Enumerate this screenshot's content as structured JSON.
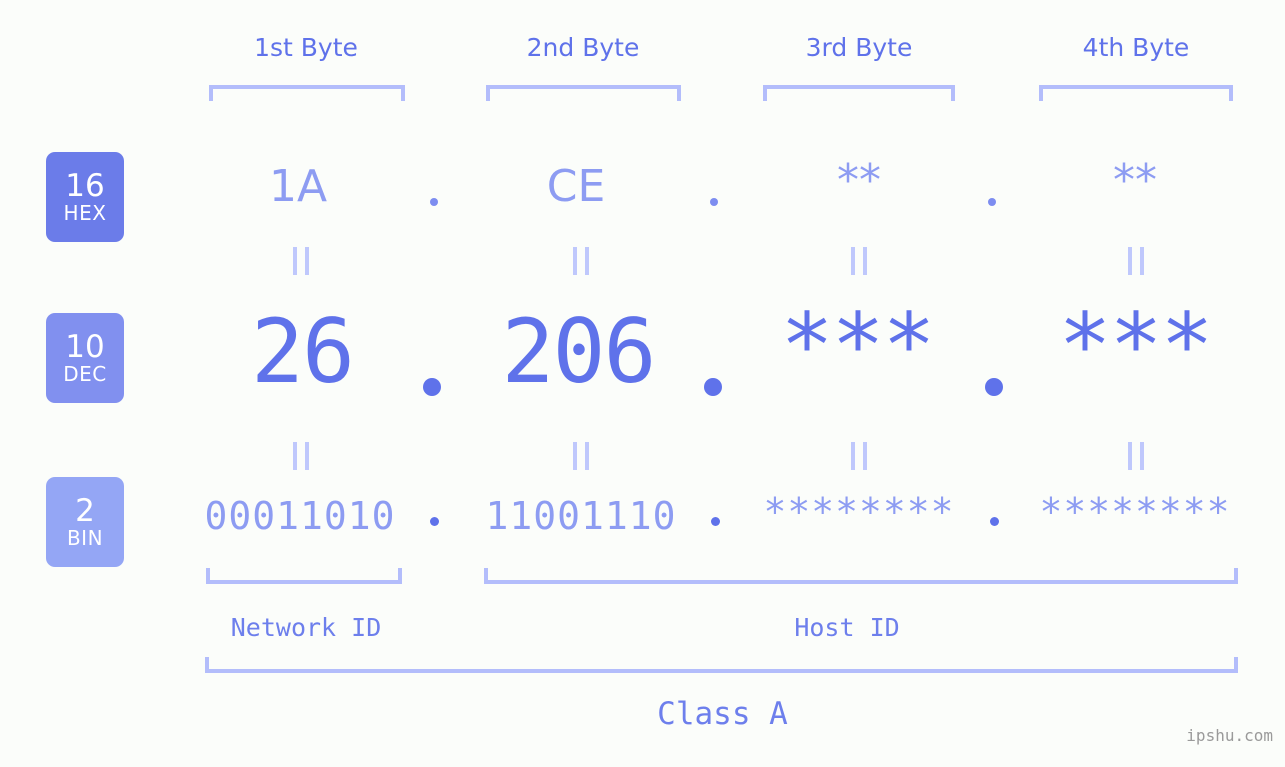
{
  "meta": {
    "background_color": "#fbfdfa",
    "accent_color": "#5f72ea",
    "accent_light_color": "#8d9cf2",
    "bracket_color": "#b3bdfb",
    "watermark": "ipshu.com"
  },
  "headers": {
    "byte1": "1st Byte",
    "byte2": "2nd Byte",
    "byte3": "3rd Byte",
    "byte4": "4th Byte"
  },
  "radix_badges": [
    {
      "number": "16",
      "label": "HEX",
      "color": "#6b7ce9"
    },
    {
      "number": "10",
      "label": "DEC",
      "color": "#8190ef"
    },
    {
      "number": "2",
      "label": "BIN",
      "color": "#94a6f5"
    }
  ],
  "rows": {
    "hex": {
      "byte1": "1A",
      "byte2": "CE",
      "byte3": "**",
      "byte4": "**",
      "separator": "."
    },
    "dec": {
      "byte1": "26",
      "byte2": "206",
      "byte3": "***",
      "byte4": "***",
      "separator": "."
    },
    "bin": {
      "byte1": "00011010",
      "byte2": "11001110",
      "byte3": "********",
      "byte4": "********",
      "separator": "."
    }
  },
  "equals_marks": {
    "symbol": "="
  },
  "sections": {
    "network_id": "Network ID",
    "host_id": "Host ID",
    "class": "Class A"
  }
}
